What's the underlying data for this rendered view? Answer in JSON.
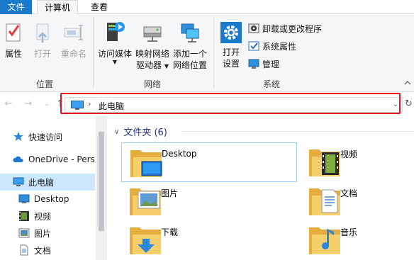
{
  "tabs": {
    "file": "文件",
    "computer": "计算机",
    "view": "查看"
  },
  "ribbon": {
    "location": {
      "label": "位置",
      "properties": "属性",
      "open": "打开",
      "rename": "重命名"
    },
    "network": {
      "label": "网络",
      "access_media": "访问媒体",
      "map_drive_1": "映射网络",
      "map_drive_2": "驱动器",
      "add_location_1": "添加一个",
      "add_location_2": "网络位置"
    },
    "system": {
      "label": "系统",
      "open_settings_1": "打开",
      "open_settings_2": "设置",
      "uninstall": "卸载或更改程序",
      "system_properties": "系统属性",
      "manage": "管理"
    }
  },
  "address": {
    "crumb": "此电脑"
  },
  "nav": [
    {
      "label": "快速访问",
      "icon": "star-icon"
    },
    {
      "label": "OneDrive - Perso",
      "icon": "cloud-icon"
    },
    {
      "label": "此电脑",
      "icon": "computer-icon"
    },
    {
      "label": "Desktop",
      "icon": "desktop-icon"
    },
    {
      "label": "视频",
      "icon": "video-icon"
    },
    {
      "label": "图片",
      "icon": "pictures-icon"
    },
    {
      "label": "文档",
      "icon": "documents-icon"
    }
  ],
  "content": {
    "section_title": "文件夹 (6)",
    "folders": [
      {
        "name": "Desktop",
        "icon": "desktop-folder-icon"
      },
      {
        "name": "视频",
        "icon": "videos-folder-icon"
      },
      {
        "name": "图片",
        "icon": "pictures-folder-icon"
      },
      {
        "name": "文档",
        "icon": "documents-folder-icon"
      },
      {
        "name": "下载",
        "icon": "downloads-folder-icon"
      },
      {
        "name": "音乐",
        "icon": "music-folder-icon"
      }
    ]
  },
  "colors": {
    "accent": "#1979ca",
    "highlight_box": "#e81123",
    "selection": "#cce8ff",
    "folder": "#f0c75e"
  }
}
